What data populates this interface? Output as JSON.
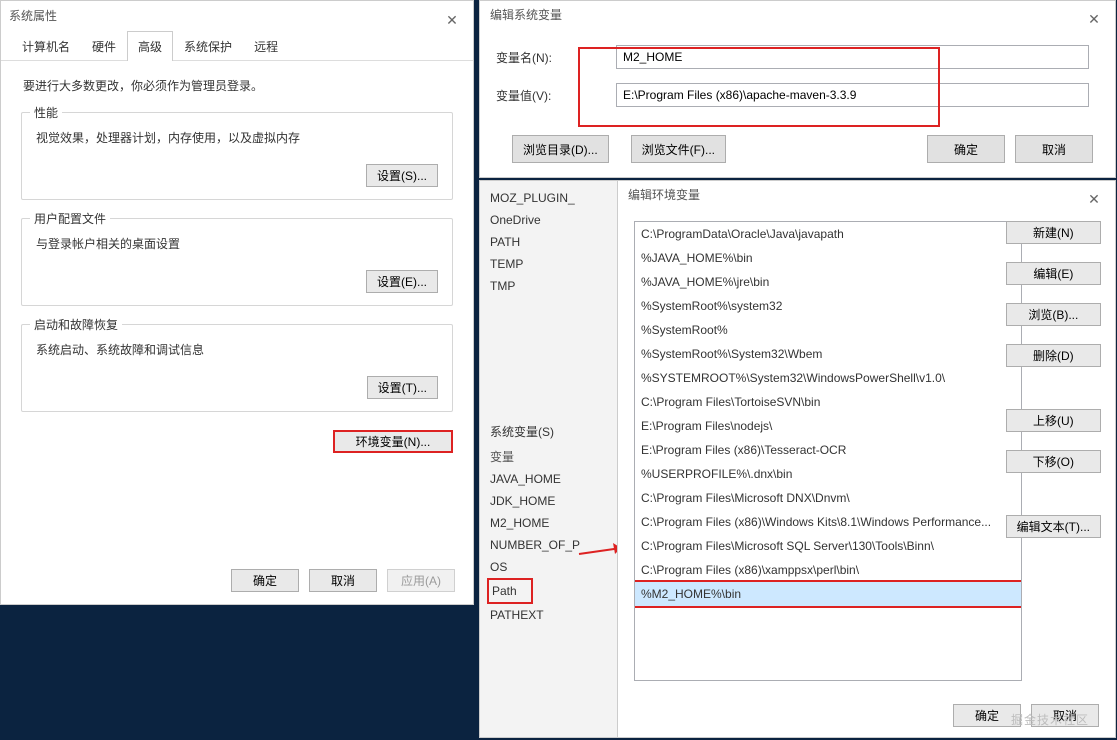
{
  "dlg1": {
    "title": "系统属性",
    "tabs": [
      "计算机名",
      "硬件",
      "高级",
      "系统保护",
      "远程"
    ],
    "active_tab": 2,
    "instruction": "要进行大多数更改，你必须作为管理员登录。",
    "groups": {
      "perf": {
        "legend": "性能",
        "desc": "视觉效果，处理器计划，内存使用，以及虚拟内存",
        "btn": "设置(S)..."
      },
      "prof": {
        "legend": "用户配置文件",
        "desc": "与登录帐户相关的桌面设置",
        "btn": "设置(E)..."
      },
      "start": {
        "legend": "启动和故障恢复",
        "desc": "系统启动、系统故障和调试信息",
        "btn": "设置(T)..."
      }
    },
    "env_btn": "环境变量(N)...",
    "footer": {
      "ok": "确定",
      "cancel": "取消",
      "apply": "应用(A)"
    }
  },
  "dlg2": {
    "title": "编辑系统变量",
    "name_label": "变量名(N):",
    "value_label": "变量值(V):",
    "name_value": "M2_HOME",
    "value_value": "E:\\Program Files (x86)\\apache-maven-3.3.9",
    "browse_dir": "浏览目录(D)...",
    "browse_file": "浏览文件(F)...",
    "ok": "确定",
    "cancel": "取消"
  },
  "midstrip": {
    "user_vars": [
      "MOZ_PLUGIN_",
      "OneDrive",
      "PATH",
      "TEMP",
      "TMP"
    ],
    "sys_label": "系统变量(S)",
    "sys_header": "变量",
    "sys_vars": [
      "JAVA_HOME",
      "JDK_HOME",
      "M2_HOME",
      "NUMBER_OF_P",
      "OS",
      "Path",
      "PATHEXT"
    ],
    "highlight": "Path"
  },
  "dlg3": {
    "title": "编辑环境变量",
    "items": [
      "C:\\ProgramData\\Oracle\\Java\\javapath",
      "%JAVA_HOME%\\bin",
      "%JAVA_HOME%\\jre\\bin",
      "%SystemRoot%\\system32",
      "%SystemRoot%",
      "%SystemRoot%\\System32\\Wbem",
      "%SYSTEMROOT%\\System32\\WindowsPowerShell\\v1.0\\",
      "C:\\Program Files\\TortoiseSVN\\bin",
      "E:\\Program Files\\nodejs\\",
      "E:\\Program Files (x86)\\Tesseract-OCR",
      "%USERPROFILE%\\.dnx\\bin",
      "C:\\Program Files\\Microsoft DNX\\Dnvm\\",
      "C:\\Program Files (x86)\\Windows Kits\\8.1\\Windows Performance...",
      "C:\\Program Files\\Microsoft SQL Server\\130\\Tools\\Binn\\",
      "C:\\Program Files (x86)\\xamppsx\\perl\\bin\\",
      "%M2_HOME%\\bin"
    ],
    "highlight_index": 15,
    "buttons": {
      "new": "新建(N)",
      "edit": "编辑(E)",
      "browse": "浏览(B)...",
      "delete": "删除(D)",
      "up": "上移(U)",
      "down": "下移(O)",
      "edit_text": "编辑文本(T)..."
    },
    "ok": "确定",
    "cancel": "取消"
  },
  "watermark": "掘金技术社区"
}
